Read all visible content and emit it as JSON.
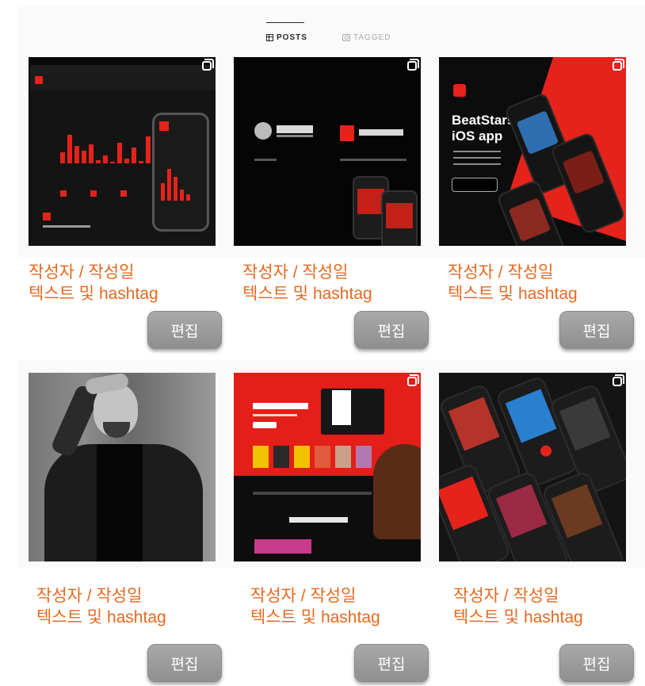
{
  "tabs": {
    "posts": "POSTS",
    "tagged": "TAGGED"
  },
  "thumbs": {
    "t3_title_line1": "BeatStars",
    "t3_title_line2": "iOS app"
  },
  "posts": [
    {
      "caption_line1": "작성자 / 작성일",
      "caption_line2": "텍스트 및 hashtag",
      "edit_label": "편집"
    },
    {
      "caption_line1": "작성자 / 작성일",
      "caption_line2": "텍스트 및 hashtag",
      "edit_label": "편집"
    },
    {
      "caption_line1": "작성자 / 작성일",
      "caption_line2": "텍스트 및 hashtag",
      "edit_label": "편집"
    },
    {
      "caption_line1": "작성자 / 작성일",
      "caption_line2": "텍스트 및 hashtag",
      "edit_label": "편집"
    },
    {
      "caption_line1": "작성자 / 작성일",
      "caption_line2": "텍스트 및 hashtag",
      "edit_label": "편집"
    },
    {
      "caption_line1": "작성자 / 작성일",
      "caption_line2": "텍스트 및 hashtag",
      "edit_label": "편집"
    }
  ],
  "colors": {
    "caption": "#e8681f",
    "accent": "#e5231b",
    "button": "#9d9d9d"
  }
}
